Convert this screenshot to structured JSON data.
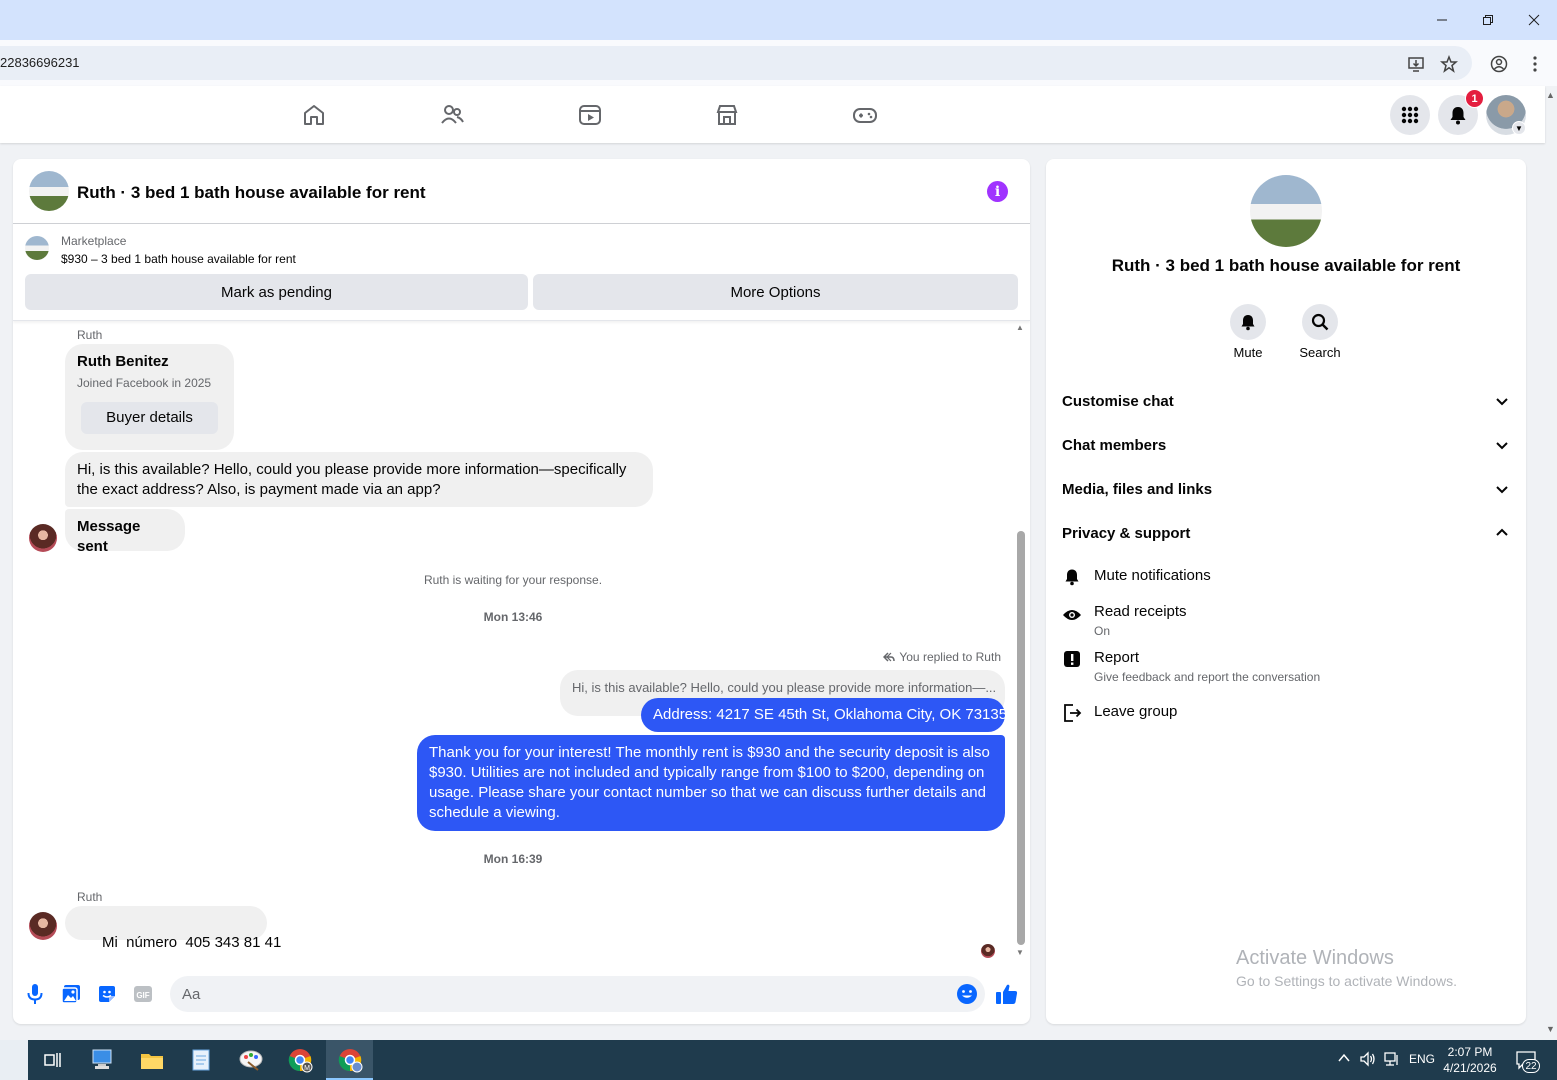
{
  "browser": {
    "url": "22836696231"
  },
  "fbnav": {
    "notification_count": "1"
  },
  "chat": {
    "title": "Ruth · 3 bed 1 bath house available for rent",
    "marketplace_label": "Marketplace",
    "listing": "$930 – 3 bed 1 bath house available for rent",
    "mark_pending_label": "Mark as pending",
    "more_options_label": "More Options",
    "messages": {
      "sender1": "Ruth",
      "profile_name": "Ruth Benitez",
      "profile_joined": "Joined Facebook in 2025",
      "buyer_details_label": "Buyer details",
      "inquiry_line1": "Hi, is this available? Hello, could you please provide more information—specifically",
      "inquiry_line2": "the exact address? Also, is payment made via an app?",
      "message_sent": "Message sent",
      "waiting_note": "Ruth is waiting for your response.",
      "ts1": "Mon 13:46",
      "replied_note": "You replied to Ruth",
      "quoted": "Hi, is this available? Hello, could you please provide more information—...",
      "address_msg": "Address: 4217 SE 45th St, Oklahoma City, OK 73135",
      "reply_line1": "Thank you for your interest! The monthly rent is $930 and the security deposit is also",
      "reply_line2": "$930. Utilities are not included and typically range from $100 to $200, depending on",
      "reply_line3": "usage. Please share your contact number so that we can discuss further details and",
      "reply_line4": "schedule a viewing.",
      "ts2": "Mon 16:39",
      "sender2": "Ruth",
      "number_msg": "Mi  número  405 343 81 41"
    },
    "composer": {
      "placeholder": "Aa"
    }
  },
  "rpanel": {
    "title": "Ruth · 3 bed 1 bath house available for rent",
    "mute_label": "Mute",
    "search_label": "Search",
    "sections": {
      "customise": "Customise chat",
      "members": "Chat members",
      "media": "Media, files and links",
      "privacy": "Privacy & support"
    },
    "privacy_items": {
      "mute": "Mute notifications",
      "receipts": "Read receipts",
      "receipts_state": "On",
      "report": "Report",
      "report_desc": "Give feedback and report the conversation",
      "leave": "Leave group"
    },
    "watermark1": "Activate Windows",
    "watermark2": "Go to Settings to activate Windows."
  },
  "taskbar": {
    "language": "ENG",
    "time": "2:07 PM",
    "date": "4/21/2026",
    "notif_count": "22"
  },
  "colors": {
    "accent": "#2d57f5",
    "info": "#a033ff",
    "badge": "#e41e3f"
  }
}
